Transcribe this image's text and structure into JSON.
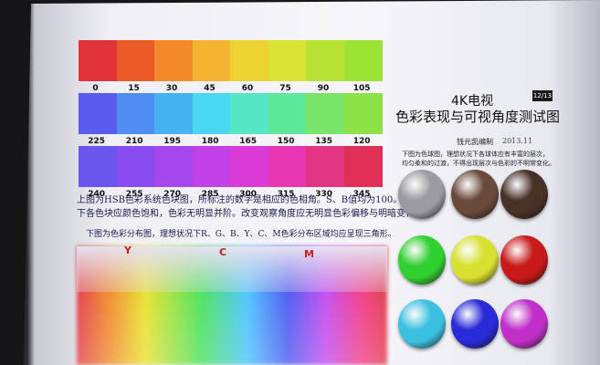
{
  "title": {
    "line1": "4K电视",
    "line2": "色彩表现与可视角度测试图",
    "author": "钱元凯编制",
    "date": "2013.11",
    "page": "12/13"
  },
  "hue_rows": [
    {
      "labels": [
        "0",
        "15",
        "30",
        "45",
        "60",
        "75",
        "90",
        "105"
      ],
      "colors": [
        "#e2333b",
        "#ec5a2a",
        "#f28a2a",
        "#f3b333",
        "#ecd330",
        "#d9e333",
        "#b6e234",
        "#9ee236"
      ]
    },
    {
      "labels": [
        "225",
        "210",
        "195",
        "180",
        "165",
        "150",
        "135",
        "120"
      ],
      "colors": [
        "#5a5cf0",
        "#4f8df3",
        "#46b2f2",
        "#48d6f0",
        "#55e6c6",
        "#5de79b",
        "#7ae36a",
        "#8de247"
      ]
    },
    {
      "labels": [
        "240",
        "255",
        "270",
        "285",
        "300",
        "315",
        "330",
        "345"
      ],
      "colors": [
        "#6c55ec",
        "#8a4cee",
        "#a646ec",
        "#c341e9",
        "#da3bd7",
        "#e737b2",
        "#e33682",
        "#e13057"
      ]
    }
  ],
  "paragraph1": {
    "line1": "上图为HSB色彩系统色块图，所标注的数字是相应的色相角。S、B值均为100。理想状况",
    "line2": "下各色块应颜色饱和，色彩无明显并阶。改变观察角度应无明显色彩偏移与明暗变化。"
  },
  "paragraph2": "下图为色彩分布图，理想状况下R、G、B、Y、C、M色彩分布区域均应呈现三角形。",
  "spectrum_letters": [
    "Y",
    "C",
    "M"
  ],
  "sphere_caption": {
    "line1": "下图为色球图，理想状况下各球体应有丰富的层次，",
    "line2": "均匀柔和的过渡，不得出现层次与色彩的不明常变化。"
  },
  "spheres": [
    {
      "name": "gray",
      "color": "#9a9aa0"
    },
    {
      "name": "brown",
      "color": "#6a4a3a"
    },
    {
      "name": "dark-brown",
      "color": "#4a3128"
    },
    {
      "name": "green",
      "color": "#30d030"
    },
    {
      "name": "yellow",
      "color": "#d8e030"
    },
    {
      "name": "red",
      "color": "#c81a1a"
    },
    {
      "name": "cyan",
      "color": "#3cc0e0"
    },
    {
      "name": "blue",
      "color": "#2a2ad8"
    },
    {
      "name": "magenta",
      "color": "#c030c8"
    }
  ]
}
